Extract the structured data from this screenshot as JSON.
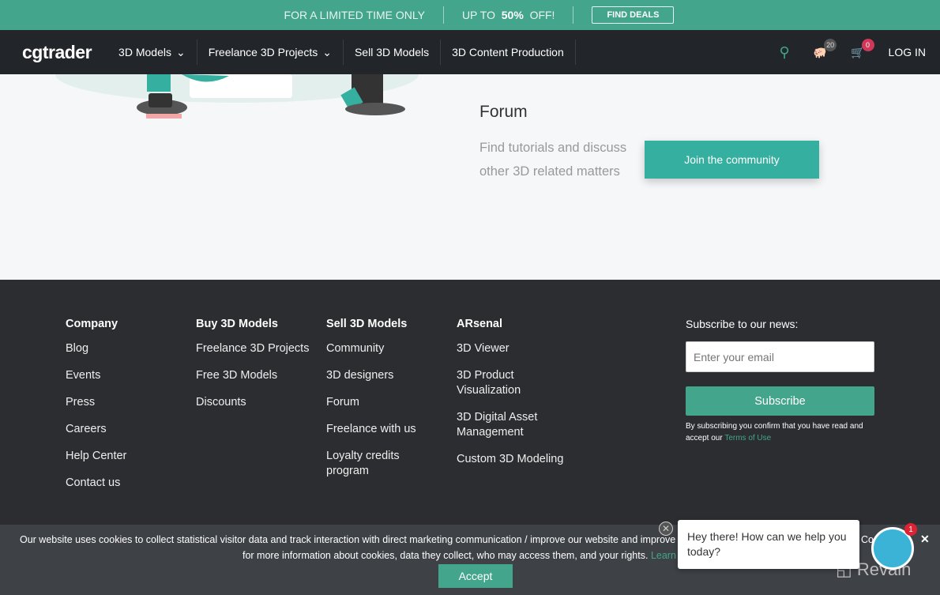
{
  "promo": {
    "text1": "FOR A LIMITED TIME ONLY",
    "text2_pre": "UP TO",
    "text2_bold": "50%",
    "text2_post": "OFF!",
    "button": "FIND DEALS"
  },
  "nav": {
    "logo": "cgtrader",
    "items": [
      "3D Models",
      "Freelance 3D Projects",
      "Sell 3D Models",
      "3D Content Production"
    ],
    "wishlist_count": "20",
    "cart_count": "0",
    "login": "LOG IN"
  },
  "forum": {
    "title": "Forum",
    "description": "Find tutorials and discuss other 3D related matters",
    "button": "Join the community"
  },
  "footer": {
    "columns": [
      {
        "title": "Company",
        "links": [
          "Blog",
          "Events",
          "Press",
          "Careers",
          "Help Center",
          "Contact us"
        ]
      },
      {
        "title": "Buy 3D Models",
        "links": [
          "Freelance 3D Projects",
          "Free 3D Models",
          "Discounts"
        ]
      },
      {
        "title": "Sell 3D Models",
        "links": [
          "Community",
          "3D designers",
          "Forum",
          "Freelance with us",
          "Loyalty credits program"
        ]
      },
      {
        "title": "ARsenal",
        "links": [
          "3D Viewer",
          "3D Product Visualization",
          "3D Digital Asset Management",
          "Custom 3D Modeling"
        ]
      }
    ],
    "subscribe": {
      "title": "Subscribe to our news:",
      "placeholder": "Enter your email",
      "button": "Subscribe",
      "note": "By subscribing you confirm that you have read and accept our",
      "terms": "Terms of Use"
    }
  },
  "cookie": {
    "line1": "Our website uses cookies to collect statistical visitor data and track interaction with direct marketing communication / improve our website and improve",
    "line1_end": "Co    ce",
    "line2": "for more information about cookies, data they collect, who may access them, and your rights.",
    "learn": "Learn m",
    "accept": "Accept"
  },
  "chat": {
    "message": "Hey there! How can we help you today?",
    "badge": "1"
  },
  "watermark": "Revain"
}
